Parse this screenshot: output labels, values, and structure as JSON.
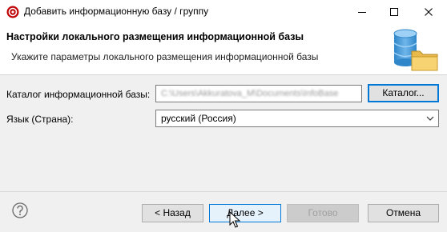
{
  "window": {
    "title": "Добавить информационную базу / группу",
    "app_icon": "1c-icon",
    "controls": [
      "minimize-icon",
      "maximize-icon",
      "close-icon"
    ]
  },
  "header": {
    "title": "Настройки локального размещения информационной базы",
    "subtitle": "Укажите параметры локального размещения информационной базы",
    "image": "database-folder-icon"
  },
  "form": {
    "catalog_label": "Каталог информационной базы:",
    "catalog_value": "C:\\Users\\Akkuratova_M\\Documents\\InfoBase",
    "catalog_button": "Каталог...",
    "language_label": "Язык (Страна):",
    "language_value": "русский (Россия)"
  },
  "footer": {
    "help_icon": "question-circle-icon",
    "back_button": "< Назад",
    "next_button": "Далее >",
    "done_button": "Готово",
    "cancel_button": "Отмена"
  },
  "colors": {
    "accent": "#0078d7",
    "app_icon_red": "#c00000"
  }
}
